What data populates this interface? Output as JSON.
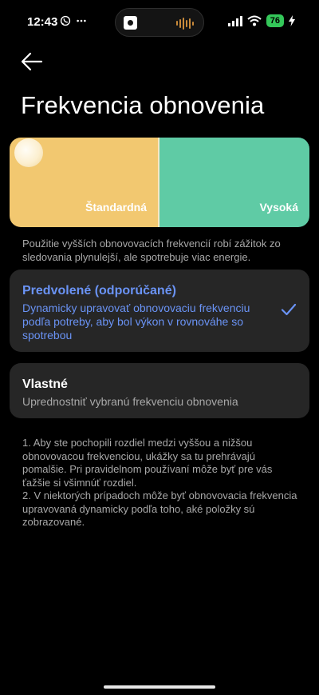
{
  "status_bar": {
    "time": "12:43",
    "battery": "76",
    "icons": [
      "whatsapp-icon",
      "more-icon",
      "signal-icon",
      "wifi-icon",
      "charging-icon"
    ]
  },
  "header": {
    "title": "Frekvencia obnovenia",
    "back_icon": "back-arrow-icon"
  },
  "preview": {
    "standard_label": "Štandardná",
    "high_label": "Vysoká",
    "colors": {
      "standard": "#f2c870",
      "high": "#5fcba5"
    }
  },
  "description": "Použitie vyšších obnovovacích frekvencií robí zážitok zo sledovania plynulejší, ale spotrebuje viac energie.",
  "options": [
    {
      "title": "Predvolené (odporúčané)",
      "description": "Dynamicky upravovať obnovovaciu frekvenciu podľa potreby, aby bol výkon v rovnováhe so spotrebou",
      "selected": true
    },
    {
      "title": "Vlastné",
      "description": "Uprednostniť vybranú frekvenciu obnovenia",
      "selected": false
    }
  ],
  "notes": [
    "1. Aby ste pochopili rozdiel medzi vyššou a nižšou obnovovacou frekvenciou, ukážky sa tu prehrávajú pomalšie. Pri pravidelnom používaní môže byť pre vás ťažšie si všimnúť rozdiel.",
    "2. V niektorých prípadoch môže byť obnovovacia frekvencia upravovaná dynamicky podľa toho, aké položky sú zobrazované."
  ],
  "accent_color": "#6a93f5"
}
